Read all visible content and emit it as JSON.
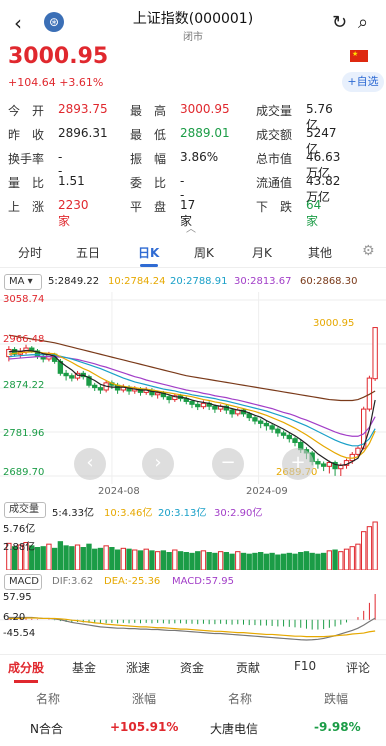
{
  "header": {
    "title": "上证指数(000001)",
    "subtitle": "闭市",
    "back_icon": "‹",
    "logo_icon": "⊛",
    "refresh_icon": "↻",
    "search_icon": "⌕"
  },
  "quote": {
    "price": "3000.95",
    "change": "+104.64  +3.61%",
    "add_label": "+自选",
    "flag_icon": "cn-flag"
  },
  "stats": [
    {
      "label": "今　开",
      "value": "2893.75",
      "color": "red"
    },
    {
      "label": "最　高",
      "value": "3000.95",
      "color": "red"
    },
    {
      "label": "成交量",
      "value": "5.76亿",
      "color": "blk"
    },
    {
      "label": "昨　收",
      "value": "2896.31",
      "color": "blk"
    },
    {
      "label": "最　低",
      "value": "2889.01",
      "color": "green"
    },
    {
      "label": "成交额",
      "value": "5247亿",
      "color": "blk"
    },
    {
      "label": "换手率",
      "value": "--",
      "color": "blk"
    },
    {
      "label": "振　幅",
      "value": "3.86%",
      "color": "blk"
    },
    {
      "label": "总市值",
      "value": "46.63万亿",
      "color": "blk"
    },
    {
      "label": "量　比",
      "value": "1.51",
      "color": "blk"
    },
    {
      "label": "委　比",
      "value": "--",
      "color": "blk"
    },
    {
      "label": "流通值",
      "value": "43.82万亿",
      "color": "blk"
    },
    {
      "label": "上　涨",
      "value": "2230家",
      "color": "red"
    },
    {
      "label": "平　盘",
      "value": "17家",
      "color": "blk"
    },
    {
      "label": "下　跌",
      "value": "64家",
      "color": "green"
    }
  ],
  "chart_tabs": [
    "分时",
    "五日",
    "日K",
    "周K",
    "月K",
    "其他"
  ],
  "active_chart_tab": "日K",
  "ma": {
    "selector": "MA",
    "ma5": "5:2849.22",
    "ma10": "10:2784.24",
    "ma20": "20:2788.91",
    "ma30": "30:2813.67",
    "ma60": "60:2868.30"
  },
  "price_axis": {
    "top": "3058.74",
    "l2": "2966.48",
    "l3": "2874.22",
    "l4": "2781.96",
    "bottom": "2689.70"
  },
  "annotations": {
    "high": "3000.95",
    "low": "2689.70"
  },
  "dates": [
    "2024-08",
    "2024-09"
  ],
  "volume": {
    "label": "成交量",
    "v5": "5:4.33亿",
    "v10": "10:3.46亿",
    "v20": "20:3.13亿",
    "v30": "30:2.90亿",
    "axis_top": "5.76亿",
    "axis_mid": "2.88亿"
  },
  "macd": {
    "label": "MACD",
    "dif": "DIF:3.62",
    "dea": "DEA:-25.36",
    "macd": "MACD:57.95",
    "axis_top": "57.95",
    "axis_mid": "6.20",
    "axis_bottom": "-45.54"
  },
  "bottom_tabs": [
    "成分股",
    "基金",
    "涨速",
    "资金",
    "贡献",
    "F10",
    "评论"
  ],
  "table": {
    "headers": [
      "名称",
      "涨幅",
      "名称",
      "跌幅"
    ],
    "row": [
      "N合合",
      "+105.91%",
      "大唐电信",
      "-9.98%"
    ]
  },
  "chart_data": {
    "type": "candlestick",
    "y_range": [
      2689.7,
      3058.74
    ],
    "candles": [
      [
        2940,
        2955,
        2930,
        2962
      ],
      [
        2955,
        2945,
        2940,
        2960
      ],
      [
        2945,
        2950,
        2938,
        2958
      ],
      [
        2950,
        2958,
        2945,
        2965
      ],
      [
        2958,
        2952,
        2948,
        2962
      ],
      [
        2952,
        2940,
        2935,
        2956
      ],
      [
        2940,
        2935,
        2928,
        2945
      ],
      [
        2935,
        2945,
        2930,
        2950
      ],
      [
        2945,
        2930,
        2925,
        2948
      ],
      [
        2930,
        2905,
        2900,
        2935
      ],
      [
        2905,
        2900,
        2890,
        2912
      ],
      [
        2900,
        2895,
        2888,
        2905
      ],
      [
        2895,
        2905,
        2890,
        2910
      ],
      [
        2905,
        2898,
        2892,
        2910
      ],
      [
        2898,
        2880,
        2875,
        2902
      ],
      [
        2880,
        2875,
        2868,
        2885
      ],
      [
        2875,
        2870,
        2862,
        2880
      ],
      [
        2870,
        2885,
        2865,
        2890
      ],
      [
        2885,
        2880,
        2872,
        2890
      ],
      [
        2880,
        2870,
        2862,
        2885
      ],
      [
        2870,
        2876,
        2865,
        2882
      ],
      [
        2876,
        2868,
        2860,
        2880
      ],
      [
        2868,
        2872,
        2862,
        2878
      ],
      [
        2872,
        2865,
        2858,
        2876
      ],
      [
        2865,
        2870,
        2860,
        2876
      ],
      [
        2870,
        2860,
        2855,
        2874
      ],
      [
        2860,
        2864,
        2852,
        2868
      ],
      [
        2864,
        2856,
        2850,
        2868
      ],
      [
        2856,
        2850,
        2842,
        2860
      ],
      [
        2850,
        2858,
        2845,
        2862
      ],
      [
        2858,
        2852,
        2846,
        2862
      ],
      [
        2852,
        2846,
        2840,
        2856
      ],
      [
        2846,
        2840,
        2832,
        2850
      ],
      [
        2840,
        2835,
        2828,
        2845
      ],
      [
        2835,
        2842,
        2830,
        2848
      ],
      [
        2842,
        2836,
        2828,
        2846
      ],
      [
        2836,
        2830,
        2822,
        2840
      ],
      [
        2830,
        2836,
        2824,
        2840
      ],
      [
        2836,
        2828,
        2820,
        2840
      ],
      [
        2828,
        2820,
        2812,
        2832
      ],
      [
        2820,
        2828,
        2815,
        2832
      ],
      [
        2828,
        2820,
        2814,
        2832
      ],
      [
        2820,
        2812,
        2805,
        2824
      ],
      [
        2812,
        2805,
        2798,
        2816
      ],
      [
        2805,
        2800,
        2790,
        2810
      ],
      [
        2800,
        2795,
        2785,
        2805
      ],
      [
        2795,
        2788,
        2780,
        2800
      ],
      [
        2788,
        2780,
        2772,
        2792
      ],
      [
        2780,
        2775,
        2768,
        2785
      ],
      [
        2775,
        2768,
        2760,
        2780
      ],
      [
        2768,
        2760,
        2752,
        2772
      ],
      [
        2760,
        2745,
        2738,
        2765
      ],
      [
        2745,
        2738,
        2725,
        2750
      ],
      [
        2738,
        2720,
        2712,
        2742
      ],
      [
        2720,
        2715,
        2705,
        2726
      ],
      [
        2715,
        2710,
        2700,
        2720
      ],
      [
        2710,
        2718,
        2695,
        2722
      ],
      [
        2718,
        2705,
        2690,
        2722
      ],
      [
        2705,
        2712,
        2689.7,
        2716
      ],
      [
        2712,
        2722,
        2705,
        2726
      ],
      [
        2722,
        2735,
        2715,
        2740
      ],
      [
        2735,
        2748,
        2730,
        2752
      ],
      [
        2748,
        2830,
        2745,
        2835
      ],
      [
        2830,
        2895,
        2825,
        2900
      ],
      [
        2893.75,
        3000.95,
        2889.01,
        3000.95
      ]
    ],
    "ma5": [
      2950,
      2952,
      2951,
      2953,
      2952,
      2950,
      2946,
      2944,
      2941,
      2929,
      2920,
      2912,
      2901,
      2901,
      2896,
      2890,
      2882,
      2878,
      2876,
      2876,
      2876,
      2874,
      2872,
      2870,
      2870,
      2867,
      2866,
      2863,
      2860,
      2856,
      2855,
      2853,
      2849,
      2846,
      2844,
      2842,
      2838,
      2836,
      2834,
      2831,
      2828,
      2826,
      2822,
      2817,
      2813,
      2806,
      2800,
      2794,
      2788,
      2781,
      2774,
      2766,
      2757,
      2747,
      2736,
      2728,
      2720,
      2714,
      2712,
      2714,
      2720,
      2727,
      2751,
      2788,
      2849
    ],
    "ma10": [
      2945,
      2947,
      2948,
      2949,
      2950,
      2950,
      2948,
      2947,
      2946,
      2940,
      2934,
      2928,
      2921,
      2915,
      2910,
      2903,
      2896,
      2890,
      2884,
      2880,
      2878,
      2876,
      2875,
      2873,
      2872,
      2870,
      2868,
      2866,
      2864,
      2862,
      2860,
      2858,
      2856,
      2853,
      2850,
      2848,
      2845,
      2843,
      2840,
      2837,
      2834,
      2831,
      2828,
      2825,
      2821,
      2817,
      2812,
      2807,
      2802,
      2796,
      2790,
      2783,
      2776,
      2768,
      2760,
      2752,
      2745,
      2738,
      2732,
      2728,
      2727,
      2730,
      2740,
      2758,
      2784
    ],
    "ma20": [
      2940,
      2941,
      2942,
      2943,
      2944,
      2944,
      2944,
      2944,
      2943,
      2941,
      2938,
      2935,
      2931,
      2927,
      2923,
      2919,
      2915,
      2910,
      2905,
      2900,
      2895,
      2891,
      2887,
      2884,
      2881,
      2878,
      2875,
      2872,
      2870,
      2868,
      2865,
      2863,
      2860,
      2858,
      2856,
      2854,
      2852,
      2849,
      2847,
      2844,
      2841,
      2838,
      2835,
      2832,
      2829,
      2826,
      2822,
      2818,
      2814,
      2810,
      2805,
      2800,
      2795,
      2789,
      2783,
      2777,
      2771,
      2765,
      2760,
      2756,
      2753,
      2753,
      2757,
      2768,
      2789
    ],
    "ma30": [
      2935,
      2936,
      2937,
      2938,
      2939,
      2940,
      2940,
      2940,
      2940,
      2939,
      2938,
      2936,
      2934,
      2931,
      2928,
      2925,
      2921,
      2918,
      2914,
      2910,
      2906,
      2902,
      2898,
      2895,
      2891,
      2888,
      2885,
      2882,
      2879,
      2876,
      2873,
      2870,
      2868,
      2866,
      2863,
      2861,
      2858,
      2856,
      2854,
      2851,
      2849,
      2846,
      2843,
      2840,
      2837,
      2834,
      2831,
      2827,
      2823,
      2820,
      2816,
      2811,
      2807,
      2802,
      2797,
      2792,
      2787,
      2782,
      2778,
      2775,
      2773,
      2773,
      2778,
      2792,
      2814
    ],
    "ma60": [
      2985,
      2983,
      2981,
      2979,
      2977,
      2975,
      2973,
      2971,
      2969,
      2966,
      2963,
      2960,
      2957,
      2954,
      2951,
      2948,
      2945,
      2942,
      2939,
      2936,
      2933,
      2930,
      2927,
      2924,
      2921,
      2918,
      2915,
      2912,
      2909,
      2906,
      2903,
      2900,
      2898,
      2896,
      2894,
      2892,
      2890,
      2888,
      2886,
      2884,
      2882,
      2880,
      2878,
      2876,
      2874,
      2872,
      2870,
      2868,
      2866,
      2864,
      2862,
      2860,
      2858,
      2856,
      2854,
      2852,
      2850,
      2849,
      2848,
      2848,
      2848,
      2850,
      2855,
      2861,
      2868
    ],
    "volume": [
      3.2,
      2.8,
      3.0,
      3.3,
      2.9,
      2.7,
      2.8,
      3.1,
      2.6,
      3.4,
      2.9,
      2.8,
      3.0,
      2.7,
      3.1,
      2.5,
      2.6,
      2.9,
      2.7,
      2.4,
      2.6,
      2.5,
      2.4,
      2.3,
      2.5,
      2.3,
      2.2,
      2.3,
      2.1,
      2.4,
      2.2,
      2.1,
      2.0,
      2.2,
      2.3,
      2.1,
      2.0,
      2.2,
      2.1,
      1.9,
      2.2,
      2.0,
      1.9,
      2.0,
      2.1,
      1.9,
      2.0,
      1.8,
      1.9,
      2.0,
      1.9,
      2.1,
      2.2,
      2.0,
      1.9,
      2.0,
      2.3,
      2.4,
      2.2,
      2.5,
      2.8,
      3.1,
      4.6,
      5.2,
      5.76
    ],
    "macd": [
      2,
      3,
      2,
      3,
      2,
      1,
      0,
      1,
      -1,
      -3,
      -5,
      -6,
      -5,
      -6,
      -7,
      -8,
      -9,
      -8,
      -7,
      -8,
      -7,
      -8,
      -7,
      -8,
      -7,
      -8,
      -7,
      -8,
      -9,
      -8,
      -8,
      -9,
      -9,
      -10,
      -9,
      -10,
      -10,
      -9,
      -10,
      -11,
      -10,
      -11,
      -12,
      -12,
      -13,
      -13,
      -14,
      -15,
      -15,
      -16,
      -17,
      -18,
      -20,
      -22,
      -22,
      -21,
      -18,
      -15,
      -11,
      -6,
      0,
      6,
      20,
      38,
      57.95
    ],
    "dif": [
      5,
      5,
      5,
      5,
      5,
      4,
      3,
      3,
      2,
      0,
      -3,
      -6,
      -8,
      -10,
      -12,
      -14,
      -16,
      -17,
      -18,
      -19,
      -19,
      -20,
      -20,
      -21,
      -21,
      -22,
      -22,
      -23,
      -24,
      -24,
      -25,
      -26,
      -27,
      -28,
      -29,
      -30,
      -31,
      -31,
      -32,
      -33,
      -34,
      -35,
      -36,
      -37,
      -38,
      -39,
      -40,
      -41,
      -42,
      -43,
      -44,
      -45,
      -45.54,
      -45,
      -44,
      -42,
      -39,
      -36,
      -32,
      -28,
      -24,
      -19,
      -12,
      -4,
      3.62
    ],
    "dea": [
      3,
      3,
      3,
      4,
      4,
      4,
      3,
      3,
      3,
      2,
      1,
      -1,
      -2,
      -4,
      -5,
      -7,
      -8,
      -10,
      -11,
      -12,
      -13,
      -14,
      -15,
      -16,
      -16,
      -17,
      -18,
      -18,
      -19,
      -20,
      -21,
      -21,
      -22,
      -23,
      -24,
      -25,
      -26,
      -26,
      -27,
      -28,
      -29,
      -29,
      -30,
      -31,
      -32,
      -33,
      -33,
      -34,
      -35,
      -36,
      -37,
      -37,
      -38,
      -38,
      -38,
      -38,
      -37,
      -36,
      -35,
      -34,
      -32,
      -31,
      -30,
      -27,
      -25.36
    ]
  }
}
